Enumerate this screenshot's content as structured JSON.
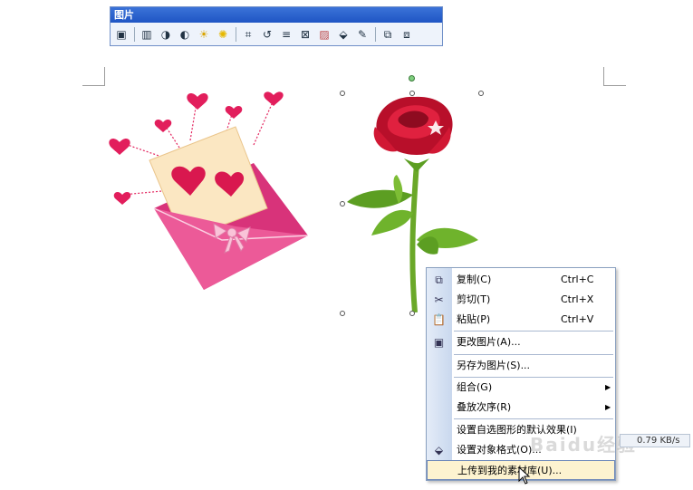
{
  "toolbar": {
    "title": "图片",
    "buttons": [
      "insert-picture-icon",
      "color-icon",
      "more-contrast-icon",
      "less-contrast-icon",
      "more-brightness-icon",
      "less-brightness-icon",
      "crop-icon",
      "rotate-left-icon",
      "line-style-icon",
      "compress-picture-icon",
      "text-wrapping-icon",
      "format-picture-icon",
      "set-transparent-color-icon",
      "reset-picture-icon",
      "reset-image-icon"
    ]
  },
  "menu": {
    "items": [
      {
        "label": "复制(C)",
        "shortcut": "Ctrl+C",
        "icon": "copy-icon"
      },
      {
        "label": "剪切(T)",
        "shortcut": "Ctrl+X",
        "icon": "scissors-icon"
      },
      {
        "label": "粘贴(P)",
        "shortcut": "Ctrl+V",
        "icon": "paste-icon"
      },
      {
        "label": "更改图片(A)...",
        "icon": "change-picture-icon"
      },
      {
        "label": "另存为图片(S)..."
      },
      {
        "label": "组合(G)",
        "submenu": true
      },
      {
        "label": "叠放次序(R)",
        "submenu": true
      },
      {
        "label": "设置自选图形的默认效果(I)"
      },
      {
        "label": "设置对象格式(O)...",
        "icon": "format-object-icon"
      },
      {
        "label": "上传到我的素材库(U)...",
        "highlighted": true
      }
    ]
  },
  "status": {
    "speed": "0.79 KB/s",
    "watermark": "Baidu经验"
  },
  "colors": {
    "rose": "#c8102e",
    "stem": "#6aa828",
    "envelope": "#e8458a",
    "heart": "#e21e5c"
  }
}
